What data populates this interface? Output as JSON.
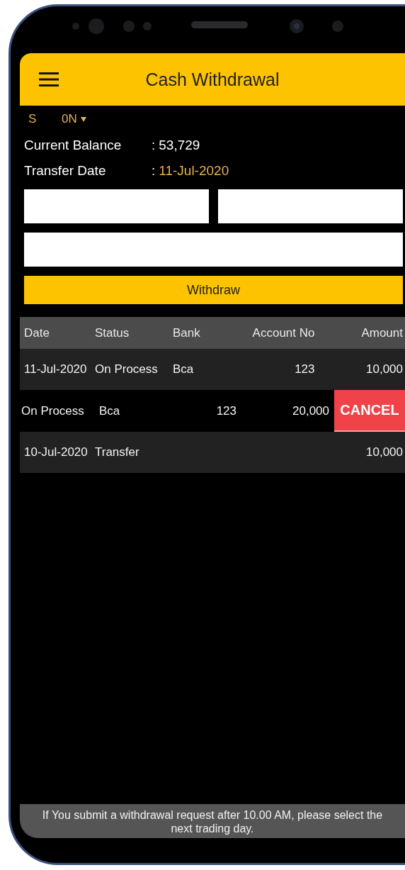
{
  "app_bar": {
    "title": "Cash Withdrawal"
  },
  "account": {
    "type": "S",
    "code": "0N"
  },
  "info": [
    {
      "label": "Current Balance",
      "separator": ":",
      "value": "53,729",
      "highlight": false
    },
    {
      "label": "Transfer Date",
      "separator": ":",
      "value": "11-Jul-2020",
      "highlight": true
    }
  ],
  "fields": [
    {
      "kind": "half"
    },
    {
      "kind": "half"
    },
    {
      "kind": "full"
    }
  ],
  "withdraw_button": "Withdraw",
  "table": {
    "columns": [
      "Date",
      "Status",
      "Bank",
      "Account No",
      "Amount"
    ],
    "rows": [
      {
        "kind": "row",
        "cells": [
          "11-Jul-2020",
          "On Process",
          "Bca",
          "123",
          "10,000"
        ]
      },
      {
        "kind": "swiped",
        "cells": [
          "On Process",
          "Bca",
          "123",
          "20,000"
        ],
        "action": "CANCEL"
      },
      {
        "kind": "row",
        "cells": [
          "10-Jul-2020",
          "Transfer",
          "",
          "",
          "10,000"
        ]
      }
    ]
  },
  "footer": "If You submit a withdrawal request after 10.00 AM, please select the next trading day."
}
